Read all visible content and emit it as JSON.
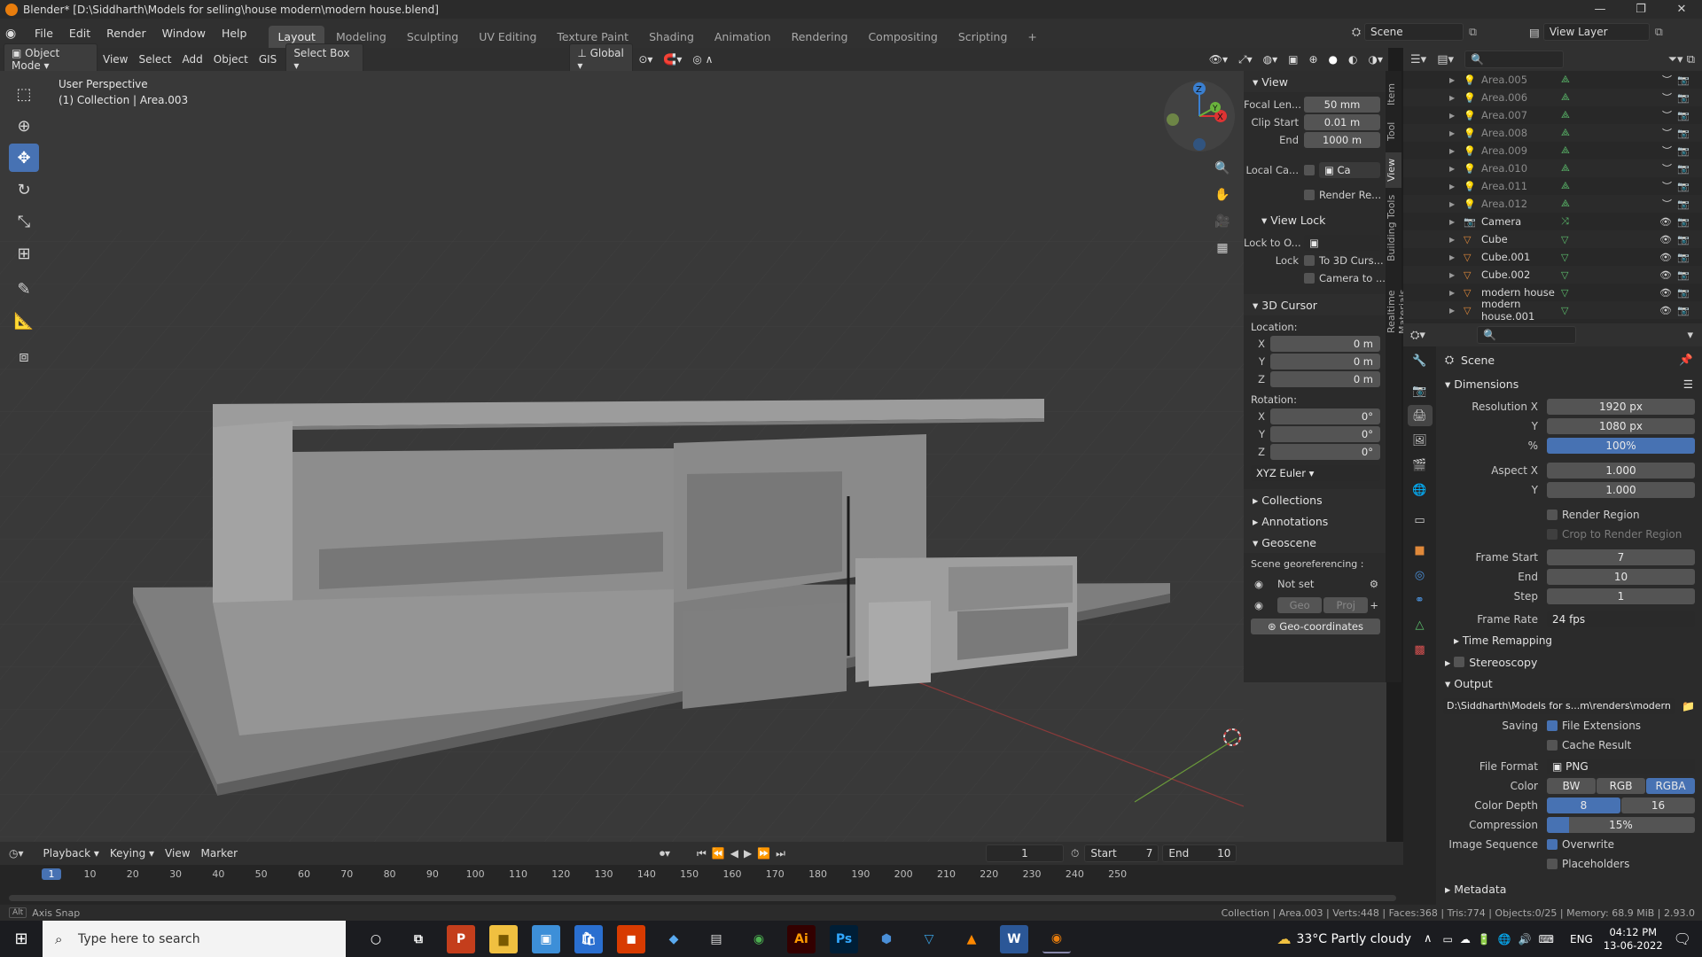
{
  "window": {
    "title": "Blender* [D:\\Siddharth\\Models for selling\\house modern\\modern house.blend]"
  },
  "menu": [
    "File",
    "Edit",
    "Render",
    "Window",
    "Help"
  ],
  "workspaces": [
    "Layout",
    "Modeling",
    "Sculpting",
    "UV Editing",
    "Texture Paint",
    "Shading",
    "Animation",
    "Rendering",
    "Compositing",
    "Scripting"
  ],
  "scene_field": "Scene",
  "view_layer_field": "View Layer",
  "viewport_header": {
    "mode": "Object Mode",
    "menus": [
      "View",
      "Select",
      "Add",
      "Object",
      "GIS"
    ],
    "select_box": "Select Box",
    "orientation": "Global"
  },
  "viewport_info": {
    "line1": "User Perspective",
    "line2": "(1) Collection | Area.003"
  },
  "npanel": {
    "view_section": "View",
    "focal_label": "Focal Len...",
    "focal_value": "50 mm",
    "clip_start_label": "Clip Start",
    "clip_start_value": "0.01 m",
    "clip_end_label": "End",
    "clip_end_value": "1000 m",
    "local_cam_label": "Local Ca...",
    "local_cam_value": "Ca",
    "render_region": "Render Re...",
    "view_lock": "View Lock",
    "lock_to_label": "Lock to O...",
    "lock_label": "Lock",
    "to_3d_cursor": "To 3D Curs...",
    "camera_to": "Camera to ...",
    "cursor_section": "3D Cursor",
    "location_label": "Location:",
    "loc_x": "0 m",
    "loc_y": "0 m",
    "loc_z": "0 m",
    "rotation_label": "Rotation:",
    "rot_x": "0°",
    "rot_y": "0°",
    "rot_z": "0°",
    "rotation_mode": "XYZ Euler",
    "collections": "Collections",
    "annotations": "Annotations",
    "geoscene": "Geoscene",
    "georef_label": "Scene georeferencing :",
    "not_set": "Not set",
    "geo_btn": "Geo",
    "proj_btn": "Proj",
    "geocoords_btn": "Geo-coordinates",
    "axis_x": "X",
    "axis_y": "Y",
    "axis_z": "Z"
  },
  "ntabs": [
    "Item",
    "Tool",
    "View",
    "Building Tools",
    "Realtime Materials"
  ],
  "outliner": [
    {
      "name": "Area.005",
      "type": "light",
      "dim": true
    },
    {
      "name": "Area.006",
      "type": "light",
      "dim": true
    },
    {
      "name": "Area.007",
      "type": "light",
      "dim": true
    },
    {
      "name": "Area.008",
      "type": "light",
      "dim": true
    },
    {
      "name": "Area.009",
      "type": "light",
      "dim": true
    },
    {
      "name": "Area.010",
      "type": "light",
      "dim": true
    },
    {
      "name": "Area.011",
      "type": "light",
      "dim": true
    },
    {
      "name": "Area.012",
      "type": "light",
      "dim": true
    },
    {
      "name": "Camera",
      "type": "camera",
      "dim": false
    },
    {
      "name": "Cube",
      "type": "mesh",
      "dim": false
    },
    {
      "name": "Cube.001",
      "type": "mesh",
      "dim": false
    },
    {
      "name": "Cube.002",
      "type": "mesh",
      "dim": false
    },
    {
      "name": "modern house",
      "type": "mesh",
      "dim": false
    },
    {
      "name": "modern house.001",
      "type": "mesh",
      "dim": false
    }
  ],
  "properties": {
    "scene_label": "Scene",
    "dimensions": "Dimensions",
    "res_x_label": "Resolution X",
    "res_x": "1920 px",
    "res_y_label": "Y",
    "res_y": "1080 px",
    "res_pct_label": "%",
    "res_pct": "100%",
    "aspect_x_label": "Aspect X",
    "aspect_x": "1.000",
    "aspect_y_label": "Y",
    "aspect_y": "1.000",
    "render_region": "Render Region",
    "crop_region": "Crop to Render Region",
    "frame_start_label": "Frame Start",
    "frame_start": "7",
    "frame_end_label": "End",
    "frame_end": "10",
    "frame_step_label": "Step",
    "frame_step": "1",
    "frame_rate_label": "Frame Rate",
    "frame_rate": "24 fps",
    "time_remap": "Time Remapping",
    "stereoscopy": "Stereoscopy",
    "output": "Output",
    "output_path": "D:\\Siddharth\\Models for s...m\\renders\\modern house",
    "saving_label": "Saving",
    "file_ext": "File Extensions",
    "cache_result": "Cache Result",
    "file_format_label": "File Format",
    "file_format": "PNG",
    "color_label": "Color",
    "color_bw": "BW",
    "color_rgb": "RGB",
    "color_rgba": "RGBA",
    "color_depth_label": "Color Depth",
    "depth_8": "8",
    "depth_16": "16",
    "compression_label": "Compression",
    "compression": "15%",
    "compression_fraction": 0.15,
    "image_seq_label": "Image Sequence",
    "overwrite": "Overwrite",
    "placeholders": "Placeholders",
    "metadata": "Metadata"
  },
  "timeline": {
    "menus": [
      "Playback",
      "Keying",
      "View",
      "Marker"
    ],
    "current_frame": "1",
    "start_label": "Start",
    "start": "7",
    "end_label": "End",
    "end": "10",
    "ticks": [
      "1",
      "10",
      "20",
      "30",
      "40",
      "50",
      "60",
      "70",
      "80",
      "90",
      "100",
      "110",
      "120",
      "130",
      "140",
      "150",
      "160",
      "170",
      "180",
      "190",
      "200",
      "210",
      "220",
      "230",
      "240",
      "250"
    ]
  },
  "statusbar": {
    "left": "Axis Snap",
    "right": "Collection | Area.003 | Verts:448 | Faces:368 | Tris:774 | Objects:0/25 | Memory: 68.9 MiB | 2.93.0"
  },
  "taskbar": {
    "search_placeholder": "Type here to search",
    "weather": "33°C  Partly cloudy",
    "lang": "ENG",
    "time": "04:12 PM",
    "date": "13-06-2022",
    "apps": [
      "P",
      "Ai",
      "Ps",
      "W"
    ]
  },
  "colors": {
    "accent": "#4772b3",
    "light_icon": "#e0893a",
    "mesh_icon": "#e0893a",
    "data_icon": "#5cbf6d"
  }
}
